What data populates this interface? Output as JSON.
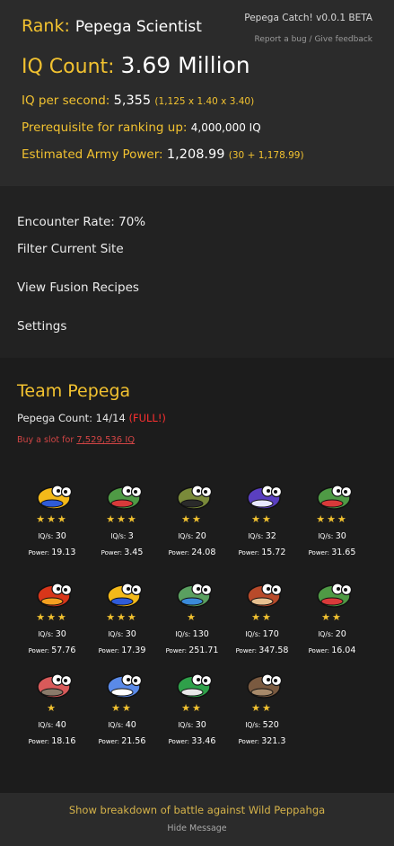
{
  "header": {
    "rank_label": "Rank:",
    "rank_value": "Pepega Scientist",
    "iq_label": "IQ Count:",
    "iq_value": "3.69 Million",
    "iqps_label": "IQ per second:",
    "iqps_value": "5,355",
    "iqps_breakdown": "(1,125 x 1.40 x 3.40)",
    "prereq_label": "Prerequisite for ranking up:",
    "prereq_value": "4,000,000 IQ",
    "army_label": "Estimated Army Power:",
    "army_value": "1,208.99",
    "army_breakdown": "(30 + 1,178.99)",
    "version": "Pepega Catch! v0.0.1 BETA",
    "feedback": "Report a bug / Give feedback"
  },
  "menu": {
    "encounter_label": "Encounter Rate:",
    "encounter_value": "70%",
    "filter": "Filter Current Site",
    "fusion": "View Fusion Recipes",
    "settings": "Settings"
  },
  "team": {
    "title": "Team Pepega",
    "count_label": "Pepega Count:",
    "count_value": "14/14",
    "full": "(FULL!)",
    "buy_text": "Buy a slot for",
    "buy_price": "7,529,536 IQ",
    "iqs_label": "IQ/s:",
    "power_label": "Power:",
    "pepegas": [
      {
        "stars": "★★★",
        "iqs": "30",
        "power": "19.13",
        "skin": "#f3b91a",
        "accent": "#2f5bd8",
        "icon": "golden-pepega-icon"
      },
      {
        "stars": "★★★",
        "iqs": "3",
        "power": "3.45",
        "skin": "#4f9a45",
        "accent": "#d83a3a",
        "icon": "pepega-icon"
      },
      {
        "stars": "★★",
        "iqs": "20",
        "power": "24.08",
        "skin": "#7a8a3a",
        "accent": "#2a2a2a",
        "icon": "soldier-pepega-icon"
      },
      {
        "stars": "★★",
        "iqs": "32",
        "power": "15.72",
        "skin": "#5a3fc0",
        "accent": "#e8e8ff",
        "icon": "purple-pepega-icon"
      },
      {
        "stars": "★★★",
        "iqs": "30",
        "power": "31.65",
        "skin": "#4f9a45",
        "accent": "#d83a3a",
        "icon": "pepega-icon"
      },
      {
        "stars": "★★★",
        "iqs": "30",
        "power": "57.76",
        "skin": "#d8361a",
        "accent": "#f5a020",
        "icon": "fire-pepega-icon"
      },
      {
        "stars": "★★★",
        "iqs": "30",
        "power": "17.39",
        "skin": "#f3b91a",
        "accent": "#2f5bd8",
        "icon": "golden-pepega-icon"
      },
      {
        "stars": "★",
        "iqs": "130",
        "power": "251.71",
        "skin": "#5aa060",
        "accent": "#3a8ad8",
        "icon": "bandana-pepega-icon"
      },
      {
        "stars": "★★",
        "iqs": "170",
        "power": "347.58",
        "skin": "#b84a2a",
        "accent": "#e8c090",
        "icon": "brown-pepega-icon"
      },
      {
        "stars": "★★",
        "iqs": "20",
        "power": "16.04",
        "skin": "#4f9a45",
        "accent": "#d83a3a",
        "icon": "pepega-icon"
      },
      {
        "stars": "★",
        "iqs": "40",
        "power": "18.16",
        "skin": "#d85a5a",
        "accent": "#8a7a6a",
        "icon": "hat-pepega-icon"
      },
      {
        "stars": "★★",
        "iqs": "40",
        "power": "21.56",
        "skin": "#5a8ae8",
        "accent": "#ffffff",
        "icon": "ice-pepega-icon"
      },
      {
        "stars": "★★",
        "iqs": "30",
        "power": "33.46",
        "skin": "#2fa04a",
        "accent": "#e8e8e8",
        "icon": "green-pepega-icon"
      },
      {
        "stars": "★★",
        "iqs": "520",
        "power": "321.3",
        "skin": "#7a5a40",
        "accent": "#a88a6a",
        "icon": "dog-pepega-icon"
      }
    ]
  },
  "footer": {
    "breakdown": "Show breakdown of battle against Wild Peppahga",
    "hide": "Hide Message"
  }
}
